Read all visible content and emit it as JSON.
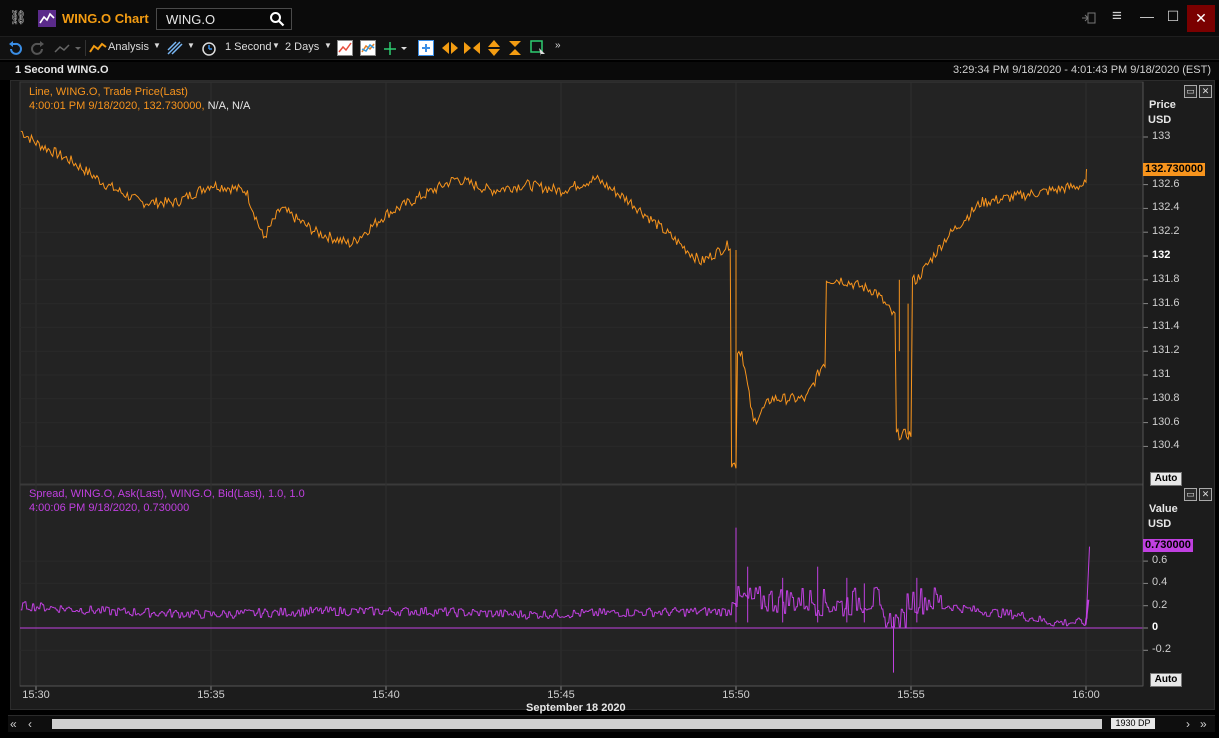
{
  "window": {
    "title": "WING.O Chart",
    "search_value": "WING.O",
    "close_glyph": "✕",
    "maximize_glyph": "☐",
    "minimize_glyph": "—",
    "menu_glyph": "≡",
    "link_glyph": "⛓"
  },
  "toolbar": {
    "analysis_label": "Analysis",
    "interval_label": "1 Second",
    "range_label": "2 Days"
  },
  "chart": {
    "title": "1 Second WING.O",
    "time_range": "3:29:34 PM 9/18/2020 - 4:01:43 PM 9/18/2020 (EST)",
    "date_label": "September 18 2020",
    "x_ticks": [
      "15:30",
      "15:35",
      "15:40",
      "15:45",
      "15:50",
      "15:55",
      "16:00"
    ],
    "datapoints_label": "1930 DP",
    "auto_label": "Auto"
  },
  "price_panel": {
    "legend_line1": "Line, WING.O, Trade Price(Last)",
    "legend_line2_value": "4:00:01 PM 9/18/2020, 132.730000,",
    "legend_line2_na": "N/A, N/A",
    "axis_title": "Price",
    "axis_unit": "USD",
    "last_value": "132.730000",
    "y_ticks": [
      "133",
      "132.6",
      "132.4",
      "132.2",
      "132",
      "131.8",
      "131.6",
      "131.4",
      "131.2",
      "131",
      "130.8",
      "130.6",
      "130.4"
    ],
    "color": "#f7941d"
  },
  "spread_panel": {
    "legend_line1": "Spread, WING.O, Ask(Last), WING.O, Bid(Last),  1.0, 1.0",
    "legend_line2": "4:00:06 PM 9/18/2020, 0.730000",
    "axis_title": "Value",
    "axis_unit": "USD",
    "last_value": "0.730000",
    "y_ticks": [
      "0.6",
      "0.4",
      "0.2",
      "0",
      "-0.2"
    ],
    "color": "#c040e0"
  },
  "chart_data": [
    {
      "type": "line",
      "series": [
        {
          "name": "WING.O Trade Price(Last)",
          "color": "#f7941d",
          "x": [
            "15:29:34",
            "15:30",
            "15:31",
            "15:32",
            "15:33",
            "15:34",
            "15:35",
            "15:36",
            "15:36:30",
            "15:37",
            "15:38",
            "15:39",
            "15:40",
            "15:41",
            "15:42",
            "15:43",
            "15:44",
            "15:45",
            "15:46",
            "15:47",
            "15:48",
            "15:49",
            "15:49:50",
            "15:50",
            "15:50:10",
            "15:50:30",
            "15:51",
            "15:52",
            "15:52:30",
            "15:53",
            "15:54",
            "15:54:30",
            "15:55",
            "15:55:10",
            "15:56",
            "15:57",
            "15:58",
            "15:59",
            "16:00",
            "16:00:01"
          ],
          "y": [
            133.05,
            132.95,
            132.8,
            132.6,
            132.45,
            132.45,
            132.6,
            132.55,
            132.15,
            132.4,
            132.2,
            132.1,
            132.35,
            132.5,
            132.65,
            132.55,
            132.6,
            132.55,
            132.65,
            132.45,
            132.2,
            131.95,
            132.1,
            130.25,
            131.2,
            130.6,
            130.8,
            130.8,
            131.1,
            131.8,
            131.7,
            131.5,
            130.5,
            131.8,
            132.15,
            132.45,
            132.5,
            132.55,
            132.6,
            132.73
          ]
        }
      ],
      "xlabel": "September 18 2020",
      "ylabel": "Price USD",
      "ylim": [
        130.2,
        133.2
      ],
      "grid": true
    },
    {
      "type": "line",
      "series": [
        {
          "name": "Spread WING.O Ask(Last) - Bid(Last)",
          "color": "#c040e0",
          "x": [
            "15:29:34",
            "15:32",
            "15:35",
            "15:38",
            "15:41",
            "15:44",
            "15:47",
            "15:49:50",
            "15:50",
            "15:50:30",
            "15:51",
            "15:52",
            "15:53",
            "15:54",
            "15:54:30",
            "15:55",
            "15:56",
            "15:57",
            "15:58",
            "15:59",
            "16:00",
            "16:00:06"
          ],
          "y": [
            0.2,
            0.15,
            0.12,
            0.15,
            0.15,
            0.12,
            0.14,
            0.15,
            0.9,
            0.35,
            0.3,
            0.25,
            0.2,
            0.3,
            -0.4,
            0.4,
            0.2,
            0.15,
            0.12,
            0.05,
            0.05,
            0.73
          ]
        }
      ],
      "ylabel": "Value USD",
      "ylim": [
        -0.4,
        0.9
      ],
      "grid": true
    }
  ]
}
